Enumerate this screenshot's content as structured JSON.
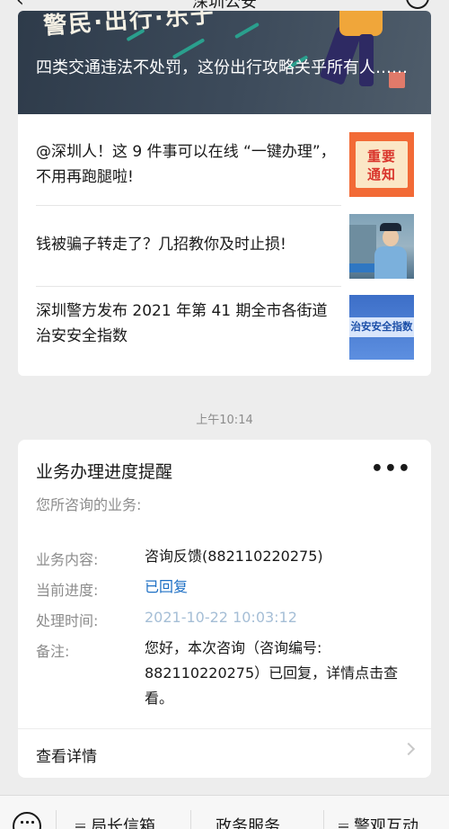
{
  "nav": {
    "title": "深圳公安"
  },
  "article": {
    "cover_banner_text": "警民·出行·乐于",
    "cover_headline": "四类交通违法不处罚，这份出行攻略关乎所有人……",
    "items": [
      {
        "text": "@深圳人！这 9 件事可以在线 “一键办理”，不用再跑腿啦!",
        "thumb_text": [
          "重要",
          "通知"
        ]
      },
      {
        "text": "钱被骗子转走了？几招教你及时止损!"
      },
      {
        "text": "深圳警方发布 2021 年第 41 期全市各街道治安安全指数",
        "thumb_text": "治安安全指数"
      }
    ]
  },
  "timestamp": "上午10:14",
  "message": {
    "title": "业务办理进度提醒",
    "subtitle": "您所咨询的业务:",
    "rows": [
      {
        "label": "业务内容:",
        "value": "咨询反馈(882110220275)"
      },
      {
        "label": "当前进度:",
        "value": "已回复"
      },
      {
        "label": "处理时间:",
        "value": "2021-10-22 10:03:12"
      },
      {
        "label": "备注:",
        "value": "您好，本次咨询（咨询编号: 882110220275）已回复，详情点击查看。"
      }
    ],
    "details_label": "查看详情",
    "more_label": "•••"
  },
  "menu": {
    "items": [
      "局长信箱",
      "政务服务",
      "警观互动"
    ]
  },
  "colors": {
    "status_blue": "#1d6fc4",
    "time_blue": "#a5bed6",
    "page_bg": "#ededed"
  }
}
